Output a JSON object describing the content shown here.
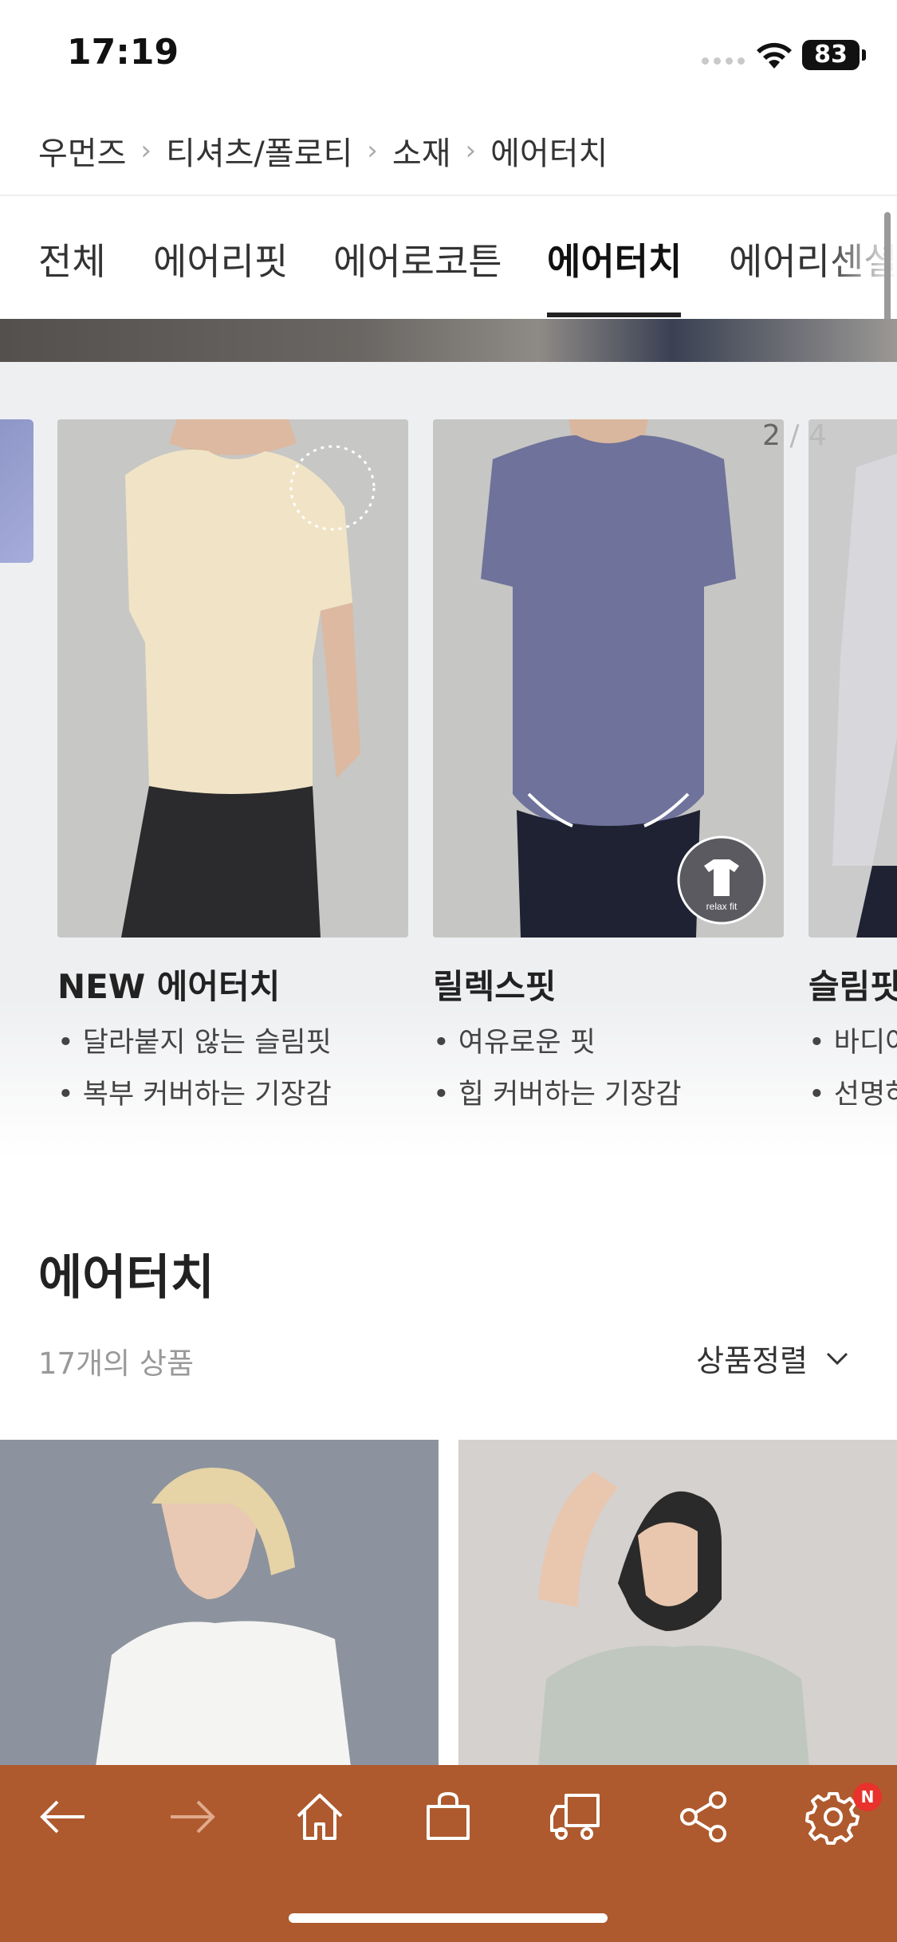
{
  "status": {
    "time": "17:19",
    "battery": "83"
  },
  "breadcrumb": [
    "우먼즈",
    "티셔츠/폴로티",
    "소재",
    "에어터치"
  ],
  "tabs": [
    {
      "label": "전체",
      "active": false
    },
    {
      "label": "에어리핏",
      "active": false
    },
    {
      "label": "에어로코튼",
      "active": false
    },
    {
      "label": "에어터치",
      "active": true
    },
    {
      "label": "에어리센셜",
      "active": false
    }
  ],
  "carousel": {
    "counter_current": "2",
    "counter_total": "4",
    "cards": [
      {
        "title": "NEW 에어터치",
        "bullets": [
          "• 달라붙지 않는 슬림핏",
          "• 복부 커버하는 기장감"
        ]
      },
      {
        "title": "릴렉스핏",
        "badge": "relax fit",
        "bullets": [
          "• 여유로운 핏",
          "• 힙 커버하는 기장감"
        ]
      },
      {
        "title": "슬림핏",
        "bullets": [
          "• 바디어",
          "• 선명하"
        ]
      }
    ]
  },
  "section": {
    "title": "에어터치",
    "count": "17개의 상품",
    "sort_label": "상품정렬"
  },
  "bottom_nav": {
    "icons": [
      "back-arrow-icon",
      "forward-arrow-icon",
      "home-icon",
      "shopping-bag-icon",
      "delivery-truck-icon",
      "share-icon",
      "settings-gear-icon"
    ],
    "badge": "N",
    "bar_color": "#ae5a2e"
  }
}
